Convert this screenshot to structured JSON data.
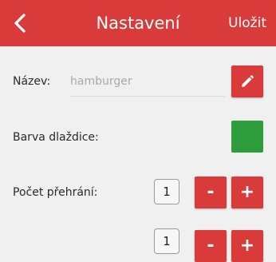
{
  "header": {
    "title": "Nastavení",
    "save_label": "Uložit",
    "back_icon": "chevron-left-icon"
  },
  "form": {
    "name_label": "Název:",
    "name_placeholder": "hamburger",
    "edit_icon": "pencil-icon",
    "tile_color_label": "Barva dlaždice:",
    "tile_color": "#2e9e3c",
    "play_count_label": "Počet přehrání:",
    "play_count_value": "1",
    "decrement_label": "-",
    "increment_label": "+",
    "second_count_value": "1",
    "second_decrement_label": "-",
    "second_increment_label": "+"
  },
  "colors": {
    "accent": "#d93a3a",
    "background": "#f0f0f0"
  }
}
